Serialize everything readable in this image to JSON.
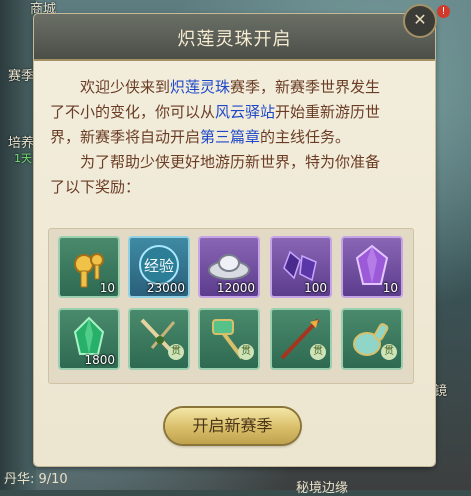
{
  "background": {
    "top_label": "商城",
    "left_label_1": "赛季",
    "left_label_2": "培养",
    "left_label_3": "1天",
    "badge": "!",
    "right_label": "镜",
    "footer_left": "丹华: 9/10",
    "footer_right": "秘境边缘"
  },
  "dialog": {
    "title": "炽莲灵珠开启",
    "close_icon": "close-icon",
    "paragraph1": {
      "t1": "欢迎少侠来到",
      "h1": "炽莲灵珠",
      "t2": "赛季，新赛季世界发生了不小的变化，你可以从",
      "h2": "风云驿站",
      "t3": "开始重新游历世界，新赛季将自动开启",
      "h3": "第三篇章",
      "t4": "的主线任务。"
    },
    "paragraph2": "为了帮助少侠更好地游历新世界，特为你准备了以下奖励：",
    "rewards": [
      {
        "icon": "gold-keys-icon",
        "count": "10",
        "tag": ""
      },
      {
        "icon": "exp-orb-icon",
        "label": "经验",
        "count": "23000",
        "tag": ""
      },
      {
        "icon": "silver-ingot-icon",
        "count": "12000",
        "tag": ""
      },
      {
        "icon": "purple-crystals-icon",
        "count": "100",
        "tag": ""
      },
      {
        "icon": "purple-gem-icon",
        "count": "10",
        "tag": ""
      },
      {
        "icon": "green-jade-icon",
        "count": "1800",
        "tag": ""
      },
      {
        "icon": "scissors-weapon-icon",
        "count": "",
        "tag": "贯"
      },
      {
        "icon": "jade-hammer-icon",
        "count": "",
        "tag": "贯"
      },
      {
        "icon": "fire-spear-icon",
        "count": "",
        "tag": "贯"
      },
      {
        "icon": "jade-gourd-icon",
        "count": "",
        "tag": "贯"
      }
    ],
    "start_button": "开启新赛季"
  },
  "colors": {
    "highlight": "#1f48c8",
    "body_text": "#6a3c25"
  }
}
